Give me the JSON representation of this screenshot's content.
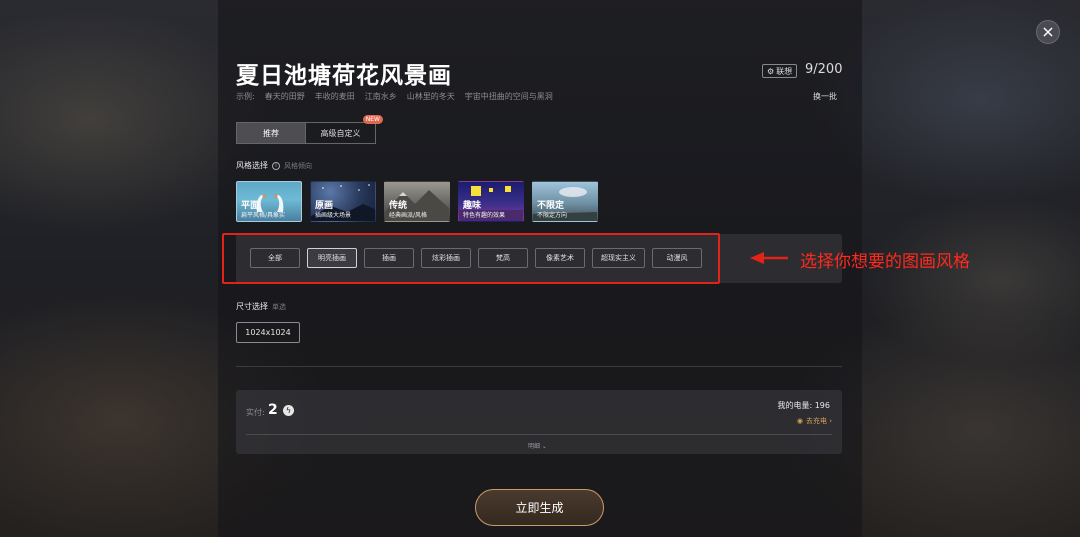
{
  "header": {
    "title": "夏日池塘荷花风景画",
    "lenovo_badge": "联想",
    "char_count": "9/200"
  },
  "examples": {
    "label": "示例:",
    "items": [
      "春天的田野",
      "丰收的麦田",
      "江南水乡",
      "山林里的冬天",
      "宇宙中扭曲的空间与黑洞"
    ],
    "refresh": "换一批"
  },
  "tabs": [
    {
      "label": "推荐",
      "active": true
    },
    {
      "label": "高级自定义",
      "badge": "NEW"
    }
  ],
  "style_section": {
    "label": "风格选择",
    "sub": "风格倾向",
    "cards": [
      {
        "title": "平面",
        "desc": "扁平风格/具象实"
      },
      {
        "title": "原画",
        "desc": "插画级大场景"
      },
      {
        "title": "传统",
        "desc": "经典画派/风格"
      },
      {
        "title": "趣味",
        "desc": "特色有趣的效果"
      },
      {
        "title": "不限定",
        "desc": "不限定方向"
      }
    ],
    "substyles": [
      "全部",
      "明亮插画",
      "插画",
      "炫彩插画",
      "梵高",
      "像素艺术",
      "超现实主义",
      "动漫风"
    ],
    "active_substyle": "明亮插画"
  },
  "annotation": {
    "text": "选择你想要的图画风格"
  },
  "size_section": {
    "label": "尺寸选择",
    "sub": "单选",
    "option": "1024x1024"
  },
  "cost": {
    "label": "实付:",
    "value": "2",
    "my_power": "我的电量: 196",
    "charge": "去充电 ›",
    "details": "明细 ⌄"
  },
  "generate_label": "立即生成",
  "colors": {
    "annotation_red": "#e2231a",
    "accent_gold": "#c89b6a"
  }
}
